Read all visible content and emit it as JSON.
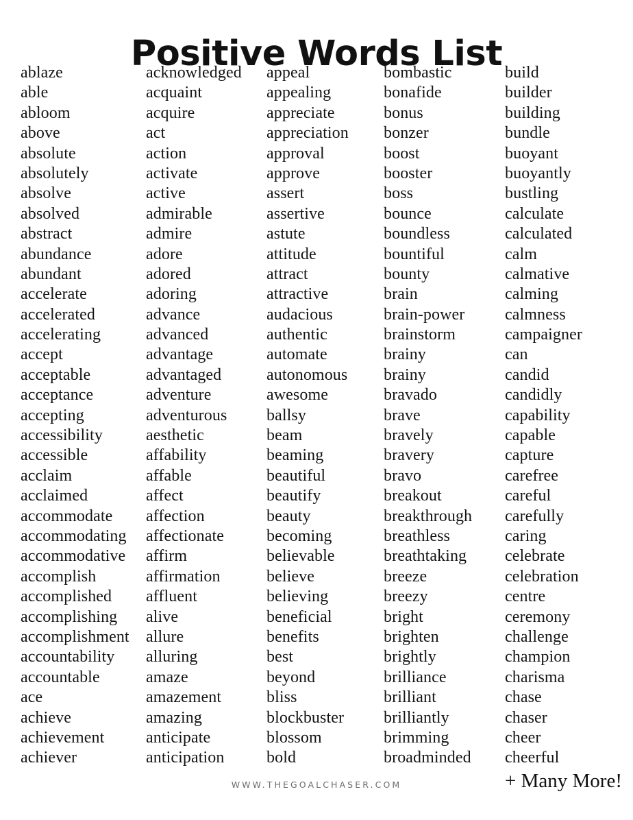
{
  "title": "Positive Words List",
  "footer": {
    "url": "WWW.THEGOALCHASER.COM",
    "many_more": "+ Many More!"
  },
  "colors": {
    "background": "#ffffff",
    "text": "#141414",
    "title": "#111111",
    "footer_url": "#6b6b6b"
  },
  "columns": [
    {
      "index": 0,
      "words": [
        "ablaze",
        "able",
        "abloom",
        "above",
        "absolute",
        "absolutely",
        "absolve",
        "absolved",
        "abstract",
        "abundance",
        "abundant",
        "accelerate",
        "accelerated",
        "accelerating",
        "accept",
        "acceptable",
        "acceptance",
        "accepting",
        "accessibility",
        "accessible",
        "acclaim",
        "acclaimed",
        "accommodate",
        "accommodating",
        "accommodative",
        "accomplish",
        "accomplished",
        "accomplishing",
        "accomplishment",
        "accountability",
        "accountable",
        "ace",
        "achieve",
        "achievement",
        "achiever"
      ]
    },
    {
      "index": 1,
      "words": [
        "acknowledged",
        "acquaint",
        "acquire",
        "act",
        "action",
        "activate",
        "active",
        "admirable",
        "admire",
        "adore",
        "adored",
        "adoring",
        "advance",
        "advanced",
        "advantage",
        "advantaged",
        "adventure",
        "adventurous",
        "aesthetic",
        "affability",
        "affable",
        "affect",
        "affection",
        "affectionate",
        "affirm",
        "affirmation",
        "affluent",
        "alive",
        "allure",
        "alluring",
        "amaze",
        "amazement",
        "amazing",
        "anticipate",
        "anticipation"
      ]
    },
    {
      "index": 2,
      "words": [
        "appeal",
        "appealing",
        "appreciate",
        "appreciation",
        "approval",
        "approve",
        "assert",
        "assertive",
        "astute",
        "attitude",
        "attract",
        "attractive",
        "audacious",
        "authentic",
        "automate",
        "autonomous",
        "awesome",
        "ballsy",
        "beam",
        "beaming",
        "beautiful",
        "beautify",
        "beauty",
        "becoming",
        "believable",
        "believe",
        "believing",
        "beneficial",
        "benefits",
        "best",
        "beyond",
        "bliss",
        "blockbuster",
        "blossom",
        "bold"
      ]
    },
    {
      "index": 3,
      "words": [
        "bombastic",
        "bonafide",
        "bonus",
        "bonzer",
        "boost",
        "booster",
        "boss",
        "bounce",
        "boundless",
        "bountiful",
        "bounty",
        "brain",
        "brain-power",
        "brainstorm",
        "brainy",
        "brainy",
        "bravado",
        "brave",
        "bravely",
        "bravery",
        "bravo",
        "breakout",
        "breakthrough",
        "breathless",
        "breathtaking",
        "breeze",
        "breezy",
        "bright",
        "brighten",
        "brightly",
        "brilliance",
        "brilliant",
        "brilliantly",
        "brimming",
        "broadminded"
      ]
    },
    {
      "index": 4,
      "words": [
        "build",
        "builder",
        "building",
        "bundle",
        "buoyant",
        "buoyantly",
        "bustling",
        "calculate",
        "calculated",
        "calm",
        "calmative",
        "calming",
        "calmness",
        "campaigner",
        "can",
        "candid",
        "candidly",
        "capability",
        "capable",
        "capture",
        "carefree",
        "careful",
        "carefully",
        "caring",
        "celebrate",
        "celebration",
        "centre",
        "ceremony",
        "challenge",
        "champion",
        "charisma",
        "chase",
        "chaser",
        "cheer",
        "cheerful"
      ]
    }
  ]
}
